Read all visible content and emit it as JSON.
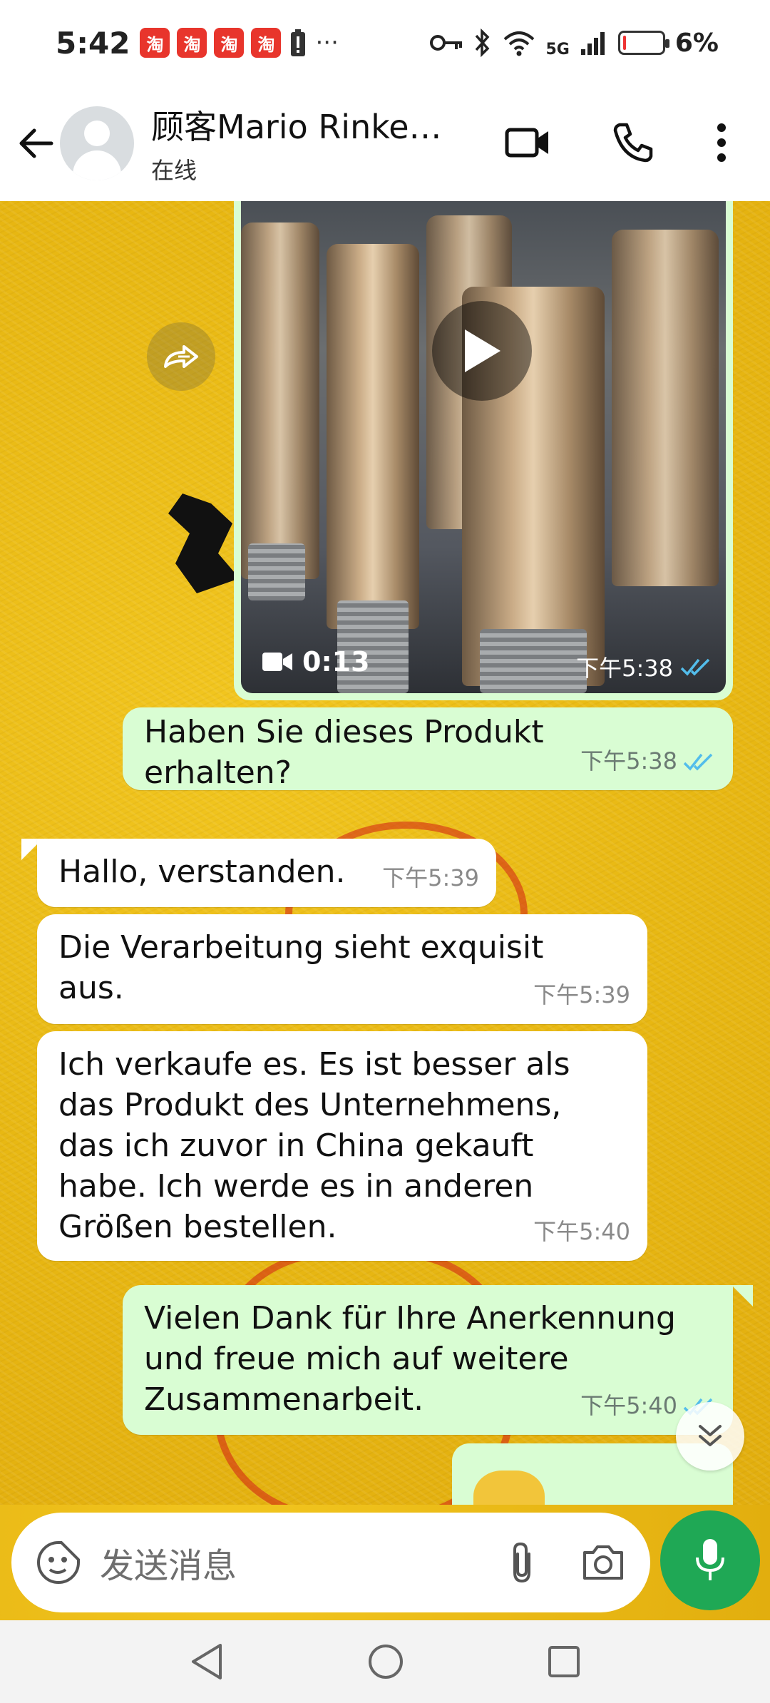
{
  "status_bar": {
    "time": "5:42",
    "app_badge": "淘",
    "extra": "···",
    "network": "5G",
    "battery_percent": "6%",
    "battery_level": 0.06
  },
  "header": {
    "contact_name": "顾客Mario Rinke…",
    "status": "在线"
  },
  "messages": {
    "video": {
      "duration": "0:13",
      "time": "下午5:38"
    },
    "m1": {
      "text": "Haben Sie dieses Produkt erhalten?",
      "time": "下午5:38"
    },
    "m2": {
      "text": "Hallo, verstanden.",
      "time": "下午5:39"
    },
    "m3": {
      "text": "Die Verarbeitung sieht exquisit aus.",
      "time": "下午5:39"
    },
    "m4": {
      "text": "Ich verkaufe es. Es ist besser als das Produkt des Unternehmens, das ich zuvor in China gekauft habe. Ich werde es in anderen Größen bestellen.",
      "time": "下午5:40"
    },
    "m5": {
      "text": "Vielen Dank für Ihre Anerkennung und freue mich auf weitere Zusammenarbeit.",
      "time": "下午5:40"
    }
  },
  "composer": {
    "placeholder": "发送消息"
  },
  "colors": {
    "outgoing_bubble": "#d9fdd3",
    "incoming_bubble": "#ffffff",
    "read_ticks": "#53bdeb",
    "mic_button": "#1fa855",
    "wallpaper": "#e8b813"
  }
}
